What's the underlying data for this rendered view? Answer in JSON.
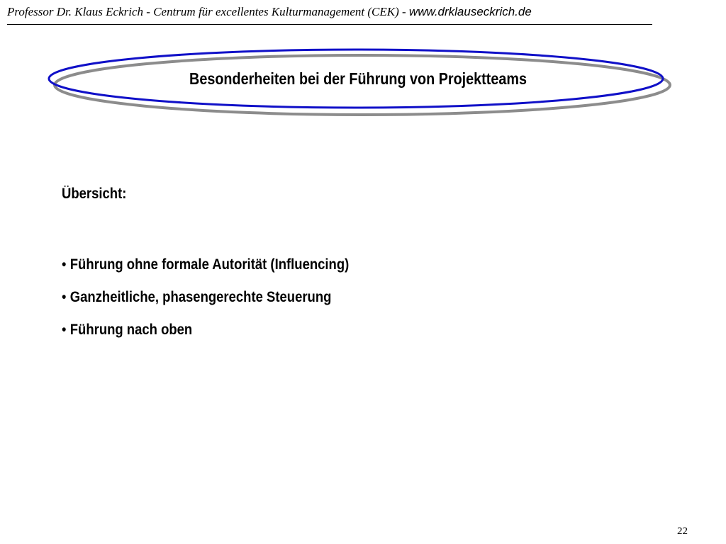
{
  "header": {
    "author_text": "Professor Dr. Klaus Eckrich - Centrum für excellentes Kulturmanagement (CEK)",
    "separator": " - ",
    "url": "www.drklauseckrich.de"
  },
  "slide": {
    "title": "Besonderheiten bei der Führung von Projektteams",
    "overview_label": "Übersicht:",
    "bullets": [
      "Führung ohne formale Autorität (Influencing)",
      "Ganzheitliche, phasengerechte Steuerung",
      "Führung nach oben"
    ],
    "bullet_glyph": "•",
    "page_number": "22"
  },
  "colors": {
    "ellipse_front": "#1010c8",
    "ellipse_shadow": "#8c8c8c",
    "header_rule": "#000000"
  }
}
